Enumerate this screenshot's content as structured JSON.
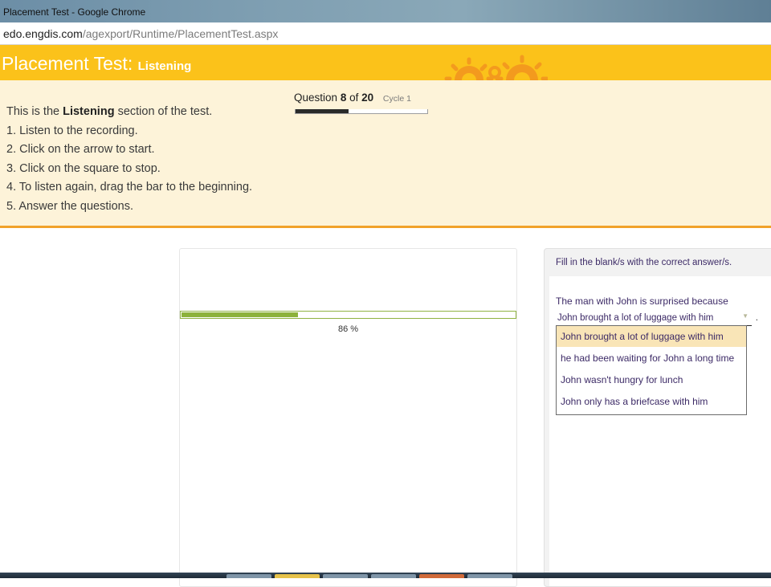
{
  "window": {
    "title": "Placement Test - Google Chrome"
  },
  "address": {
    "domain": "edo.engdis.com",
    "path": "/agexport/Runtime/PlacementTest.aspx"
  },
  "header": {
    "title": "Placement Test:",
    "section": "Listening"
  },
  "instructions": {
    "intro_pre": "This is the ",
    "intro_bold": "Listening",
    "intro_post": " section of the test.",
    "steps": [
      "1. Listen to the recording.",
      "2. Click on the arrow to start.",
      "3. Click on the square to stop.",
      "4. To listen again, drag the bar to the beginning.",
      "5. Answer the questions."
    ]
  },
  "question_counter": {
    "label": "Question",
    "current": "8",
    "of_label": "of",
    "total": "20",
    "cycle": "Cycle 1",
    "progress": 0.4
  },
  "player": {
    "progress_fraction": 0.35,
    "percent_label": "86 %"
  },
  "question": {
    "instruction": "Fill in the blank/s with the correct answer/s.",
    "text": "The man with John is surprised because",
    "selected": "John brought a lot of luggage with him",
    "punctuation": ".",
    "options": [
      "John brought a lot of luggage with him",
      "he had been waiting for John a long time",
      "John wasn't hungry for lunch",
      "John only has a briefcase with him"
    ]
  },
  "colors": {
    "header_yellow": "#fbc21a",
    "panel_cream": "#fdf3d9",
    "accent_orange": "#f1a22a",
    "progress_green": "#8cb23a",
    "option_highlight": "#f9e5b7",
    "text_purple": "#3c2a66"
  }
}
